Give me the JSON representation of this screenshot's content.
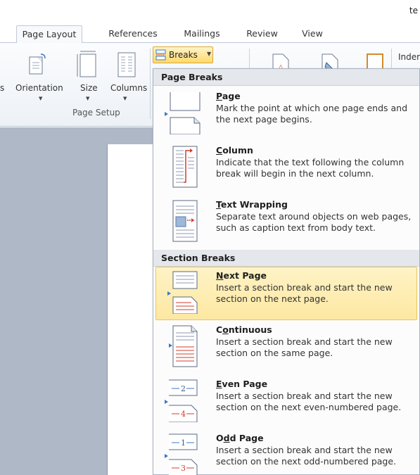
{
  "window": {
    "title_fragment": "te"
  },
  "tabs": [
    {
      "label": "Page Layout",
      "active": true
    },
    {
      "label": "References"
    },
    {
      "label": "Mailings"
    },
    {
      "label": "Review"
    },
    {
      "label": "View"
    }
  ],
  "ribbon": {
    "page_setup": {
      "margins_label_fragment": "s",
      "orientation_label": "Orientation",
      "size_label": "Size",
      "columns_label": "Columns",
      "group_caption": "Page Setup"
    },
    "breaks_button_label": "Breaks",
    "indent_label_fragment": "Inder"
  },
  "breaks_menu": {
    "page_breaks_header": "Page Breaks",
    "page_breaks": [
      {
        "key": "P",
        "rest": "age",
        "description": "Mark the point at which one page ends and the next page begins.",
        "icon": "page-break-icon"
      },
      {
        "key": "C",
        "rest": "olumn",
        "description": "Indicate that the text following the column break will begin in the next column.",
        "icon": "column-break-icon"
      },
      {
        "key": "T",
        "rest": "ext Wrapping",
        "description": "Separate text around objects on web pages, such as caption text from body text.",
        "icon": "text-wrapping-break-icon"
      }
    ],
    "section_breaks_header": "Section Breaks",
    "section_breaks": [
      {
        "key": "N",
        "rest": "ext Page",
        "description": "Insert a section break and start the new section on the next page.",
        "icon": "next-page-section-icon",
        "highlighted": true
      },
      {
        "pre": "C",
        "key": "o",
        "rest": "ntinuous",
        "description": "Insert a section break and start the new section on the same page.",
        "icon": "continuous-section-icon"
      },
      {
        "key": "E",
        "rest": "ven Page",
        "description": "Insert a section break and start the new section on the next even-numbered page.",
        "icon": "even-page-section-icon"
      },
      {
        "pre": "O",
        "key": "d",
        "rest": "d Page",
        "description": "Insert a section break and start the new section on the next odd-numbered page.",
        "icon": "odd-page-section-icon"
      }
    ]
  },
  "icon_numbers": {
    "even_top": "2",
    "even_bottom": "4",
    "odd_top": "1",
    "odd_bottom": "3"
  },
  "colors": {
    "highlight": "#fde8a2",
    "accent_red": "#d23c2c",
    "accent_blue": "#3a78c8",
    "doc_background": "#aeb8c6"
  }
}
